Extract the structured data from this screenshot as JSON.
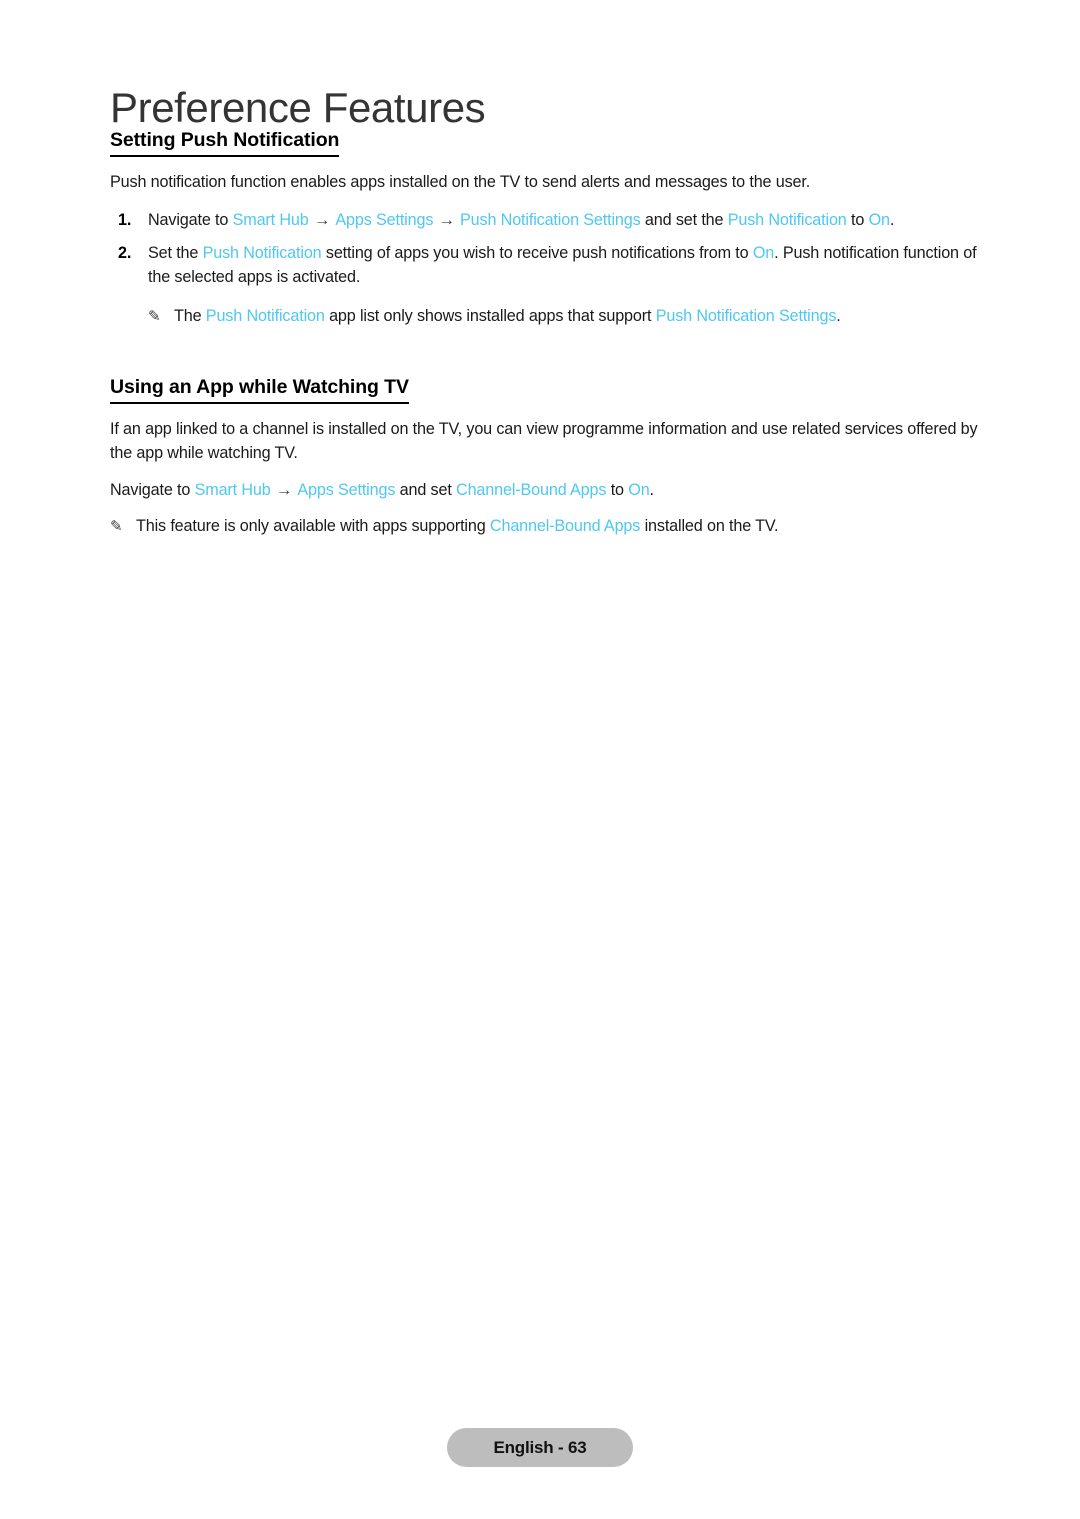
{
  "page": {
    "title": "Preference Features",
    "footer_badge": "English - 63",
    "link_color": "#4ec8f0",
    "badge_color": "#bdbdbd",
    "title_color": "#343434"
  },
  "icons": {
    "note_pencil": "✎"
  },
  "sections": [
    {
      "heading": "Setting Push Notification",
      "intro": "Push notification function enables apps installed on the TV to send alerts and messages to the user.",
      "steps": [
        {
          "number": "1.",
          "parts": [
            {
              "text": "Navigate to ",
              "type": "plain"
            },
            {
              "text": "Smart Hub",
              "type": "term"
            },
            {
              "text": " → ",
              "type": "arrow"
            },
            {
              "text": "Apps Settings",
              "type": "term"
            },
            {
              "text": " → ",
              "type": "arrow"
            },
            {
              "text": "Push Notification Settings",
              "type": "term"
            },
            {
              "text": " and set the ",
              "type": "plain"
            },
            {
              "text": "Push Notification",
              "type": "term"
            },
            {
              "text": " to ",
              "type": "plain"
            },
            {
              "text": "On",
              "type": "term"
            },
            {
              "text": ".",
              "type": "plain"
            }
          ]
        },
        {
          "number": "2.",
          "parts": [
            {
              "text": "Set the ",
              "type": "plain"
            },
            {
              "text": "Push Notification",
              "type": "term"
            },
            {
              "text": " setting of apps you wish to receive push notifications from to ",
              "type": "plain"
            },
            {
              "text": "On",
              "type": "term"
            },
            {
              "text": ". Push notification function of the selected apps is activated.",
              "type": "plain"
            }
          ]
        }
      ],
      "notes": [
        {
          "indented": true,
          "parts": [
            {
              "text": "The ",
              "type": "plain"
            },
            {
              "text": "Push Notification",
              "type": "term"
            },
            {
              "text": " app list only shows installed apps that support ",
              "type": "plain"
            },
            {
              "text": "Push Notification Settings",
              "type": "term"
            },
            {
              "text": ".",
              "type": "plain"
            }
          ]
        }
      ]
    },
    {
      "heading": "Using an App while Watching TV",
      "intro": "If an app linked to a channel is installed on the TV, you can view programme information and use related services offered by the app while watching TV.",
      "navigate_line": {
        "parts": [
          {
            "text": "Navigate to ",
            "type": "plain"
          },
          {
            "text": "Smart Hub",
            "type": "term"
          },
          {
            "text": " → ",
            "type": "arrow"
          },
          {
            "text": "Apps Settings",
            "type": "term"
          },
          {
            "text": " and set ",
            "type": "plain"
          },
          {
            "text": "Channel-Bound Apps",
            "type": "term"
          },
          {
            "text": " to ",
            "type": "plain"
          },
          {
            "text": "On",
            "type": "term"
          },
          {
            "text": ".",
            "type": "plain"
          }
        ]
      },
      "notes": [
        {
          "indented": false,
          "parts": [
            {
              "text": "This feature is only available with apps supporting ",
              "type": "plain"
            },
            {
              "text": "Channel-Bound Apps",
              "type": "term"
            },
            {
              "text": " installed on the TV.",
              "type": "plain"
            }
          ]
        }
      ]
    }
  ]
}
